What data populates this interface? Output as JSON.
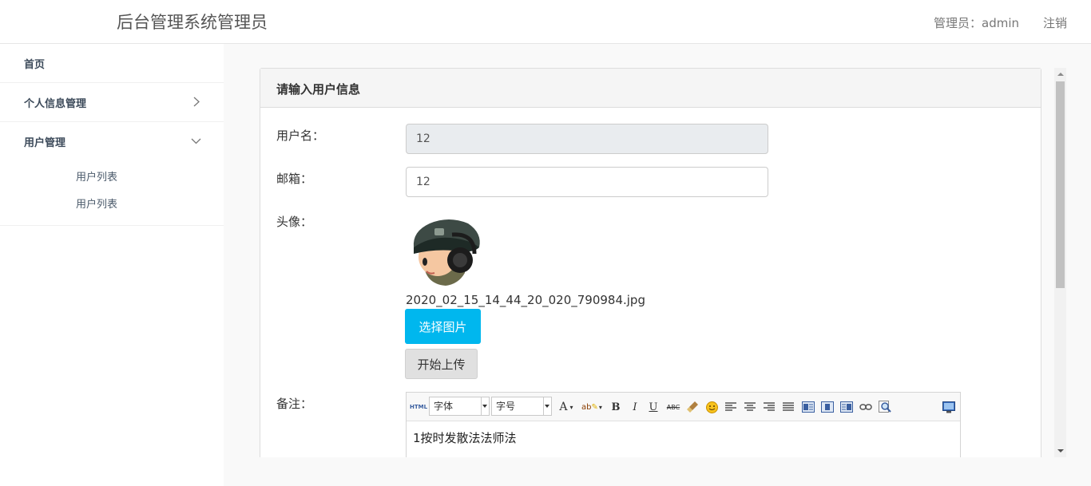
{
  "header": {
    "brand": "后台管理系统管理员",
    "user_label": "管理员：admin",
    "logout": "注销"
  },
  "sidebar": {
    "items": [
      {
        "label": "首页"
      },
      {
        "label": "个人信息管理"
      },
      {
        "label": "用户管理"
      }
    ],
    "submenu": [
      {
        "label": "用户列表"
      },
      {
        "label": "用户列表"
      }
    ]
  },
  "panel": {
    "title": "请输入用户信息"
  },
  "form": {
    "username_label": "用户名：",
    "username_value": "12",
    "email_label": "邮箱：",
    "email_value": "12",
    "avatar_label": "头像：",
    "avatar_filename": "2020_02_15_14_44_20_020_790984.jpg",
    "choose_button": "选择图片",
    "upload_button": "开始上传",
    "remark_label": "备注："
  },
  "editor": {
    "html_button": "HTML",
    "font_family": "字体",
    "font_size": "字号",
    "content": "1按时发散法法师法"
  },
  "colors": {
    "choose_button": "#00b7ee",
    "readonly_input": "#e9ecef"
  }
}
